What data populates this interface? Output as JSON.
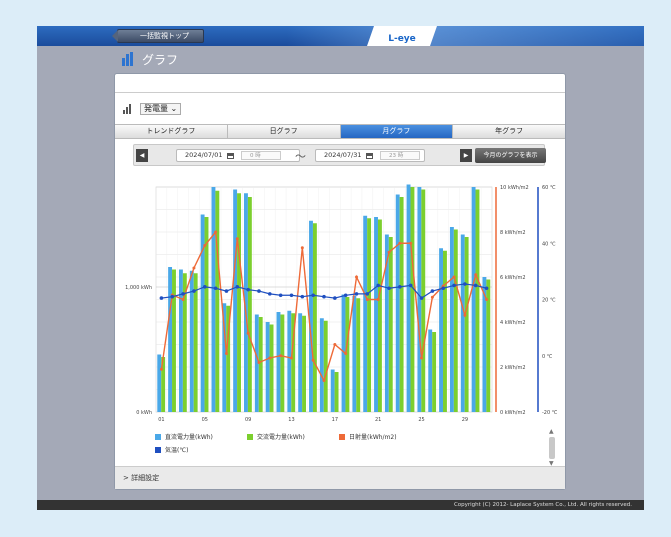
{
  "header": {
    "back_label": "一括監視トップ",
    "logo": "L-eye"
  },
  "page": {
    "title": "グラフ"
  },
  "measure": {
    "selected": "発電量",
    "chevron": "⌄"
  },
  "tabs": [
    {
      "label": "トレンドグラフ",
      "active": false
    },
    {
      "label": "日グラフ",
      "active": false
    },
    {
      "label": "月グラフ",
      "active": true
    },
    {
      "label": "年グラフ",
      "active": false
    }
  ],
  "period": {
    "prev": "◀",
    "next": "▶",
    "start_date": "2024/07/01",
    "start_time": "0 時",
    "tilde": "〜",
    "end_date": "2024/07/31",
    "end_time": "23 時",
    "show_button": "今月のグラフを表示"
  },
  "chart_data": {
    "type": "bar",
    "x": [
      1,
      2,
      3,
      4,
      5,
      6,
      7,
      8,
      9,
      10,
      11,
      12,
      13,
      14,
      15,
      16,
      17,
      18,
      19,
      20,
      21,
      22,
      23,
      24,
      25,
      26,
      27,
      28,
      29,
      30,
      31
    ],
    "x_tick_labels": [
      "01",
      "05",
      "09",
      "13",
      "17",
      "21",
      "25",
      "29"
    ],
    "y_left_label_values": [
      "1,000 kWh",
      "0 kWh"
    ],
    "y_left_range": [
      0,
      1800
    ],
    "y_irr_ticks": [
      "10 kWh/m2",
      "8 kWh/m2",
      "6 kWh/m2",
      "4 kWh/m2",
      "2 kWh/m2",
      "0 kWh/m2"
    ],
    "y_irr_range": [
      0,
      10
    ],
    "y_temp_ticks": [
      "60 ℃",
      "40 ℃",
      "20 ℃",
      "0 ℃",
      "-20 ℃"
    ],
    "y_temp_range": [
      -20,
      60
    ],
    "series": [
      {
        "name": "直流電力量(kWh)",
        "color": "#4aa8e8",
        "kind": "bar",
        "values": [
          460,
          1160,
          1140,
          1130,
          1580,
          1800,
          870,
          1780,
          1750,
          780,
          720,
          800,
          810,
          790,
          1530,
          750,
          340,
          940,
          930,
          1570,
          1560,
          1420,
          1740,
          1820,
          1800,
          660,
          1310,
          1480,
          1420,
          1800,
          1080
        ]
      },
      {
        "name": "交流電力量(kWh)",
        "color": "#7ccf2e",
        "kind": "bar",
        "values": [
          440,
          1140,
          1110,
          1110,
          1560,
          1770,
          850,
          1750,
          1720,
          760,
          700,
          780,
          790,
          770,
          1510,
          730,
          320,
          920,
          910,
          1550,
          1540,
          1400,
          1720,
          1800,
          1780,
          640,
          1290,
          1460,
          1400,
          1780,
          1060
        ]
      },
      {
        "name": "日射量(kWh/m2)",
        "color": "#ee6a38",
        "kind": "line",
        "values": [
          1.9,
          5.2,
          5.0,
          6.4,
          7.4,
          8.0,
          2.6,
          7.7,
          3.5,
          2.2,
          2.4,
          2.5,
          2.4,
          7.3,
          2.3,
          1.4,
          3.0,
          2.6,
          6.0,
          5.0,
          5.0,
          7.1,
          7.5,
          7.5,
          2.4,
          5.1,
          5.6,
          6.0,
          4.3,
          6.1,
          5.0
        ]
      },
      {
        "name": "気温(℃)",
        "color": "#1f4fc0",
        "kind": "line",
        "values": [
          20.5,
          21,
          22,
          23,
          24.5,
          24,
          23,
          24.5,
          23.5,
          23,
          22,
          21.5,
          21.5,
          21,
          21.5,
          21,
          20.5,
          21.5,
          22,
          22,
          25,
          24,
          24.5,
          25,
          20.5,
          23,
          24,
          25,
          25.5,
          25,
          24
        ]
      }
    ],
    "legend_position": "bottom-left",
    "grid": true
  },
  "detail": {
    "label": "> 詳細設定"
  },
  "footer": {
    "copyright": "Copyright (C) 2012- Laplace System Co., Ltd. All rights reserved."
  },
  "colors": {
    "accent": "#2566c2",
    "top_bar": "#1b4c9c",
    "frame": "#a4a9b7"
  }
}
